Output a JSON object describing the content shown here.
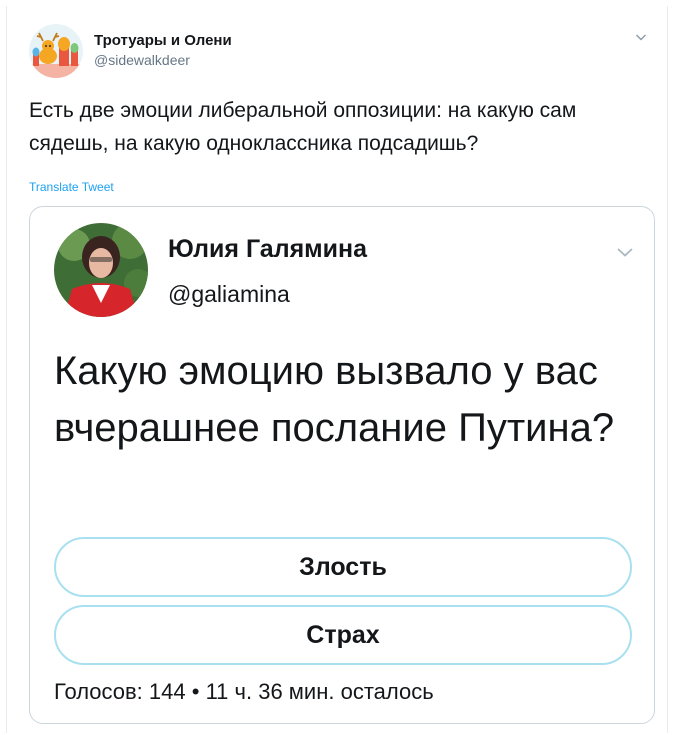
{
  "tweet": {
    "author_name": "Тротуары и Олени",
    "author_handle": "@sidewalkdeer",
    "text": "Есть две эмоции либеральной оппозиции: на какую сам сядешь, на какую одноклассника подсадишь?",
    "translate_label": "Translate Tweet",
    "avatar_icon": "deer-cathedral-avatar",
    "caret_icon": "chevron-down-icon"
  },
  "quoted_tweet": {
    "author_name": "Юлия Галямина",
    "author_handle": "@galiamina",
    "text": "Какую эмоцию вызвало у вас вчерашнее послание Путина?",
    "caret_icon": "chevron-down-icon",
    "poll": {
      "options": [
        "Злость",
        "Страх"
      ],
      "votes_label": "Голосов: 144",
      "separator": "•",
      "time_left": "11 ч. 36 мин. осталось"
    }
  },
  "colors": {
    "link_blue": "#1da1f2",
    "poll_border": "#a9e0ef",
    "secondary_text": "#657786",
    "card_border": "#ccd6dd"
  }
}
